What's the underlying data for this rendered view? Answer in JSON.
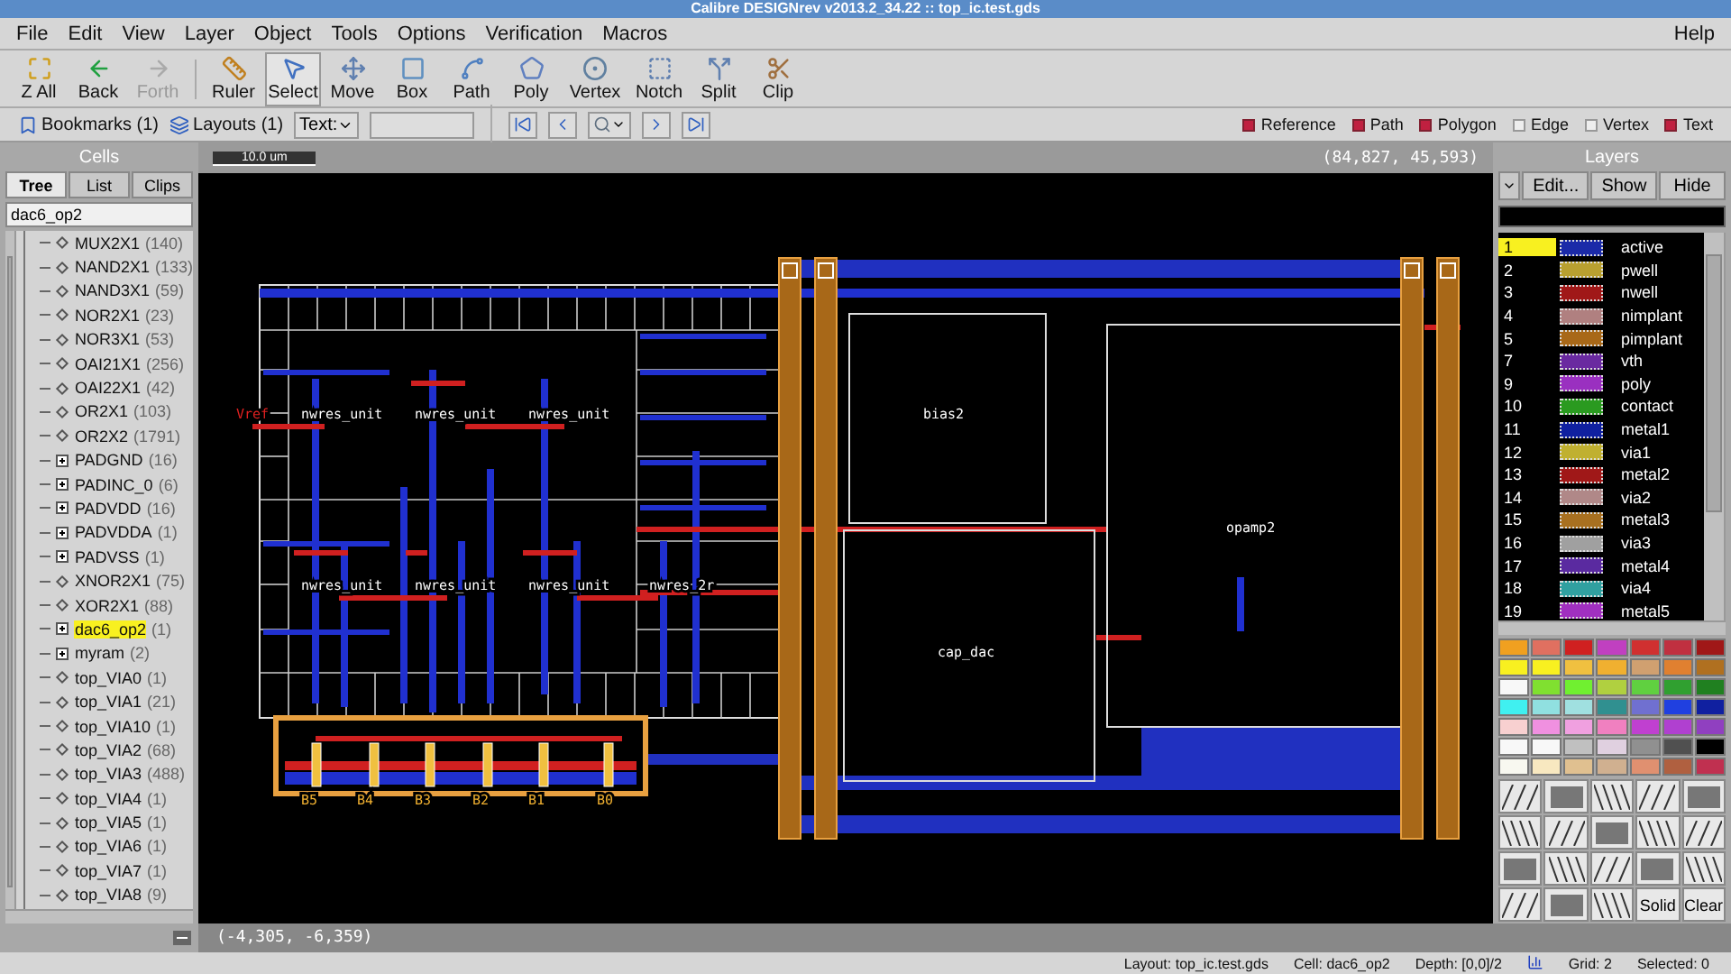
{
  "window": {
    "title": "Calibre DESIGNrev v2013.2_34.22 :: top_ic.test.gds"
  },
  "menu": {
    "left": [
      "File",
      "Edit",
      "View",
      "Layer",
      "Object",
      "Tools",
      "Options",
      "Verification",
      "Macros"
    ],
    "right": [
      "Help"
    ]
  },
  "toolbar": [
    {
      "label": "Z All",
      "disabled": false,
      "selected": false
    },
    {
      "label": "Back",
      "disabled": false,
      "selected": false
    },
    {
      "label": "Forth",
      "disabled": true,
      "selected": false
    },
    {
      "label": "Ruler",
      "disabled": false,
      "selected": false
    },
    {
      "label": "Select",
      "disabled": false,
      "selected": true
    },
    {
      "label": "Move",
      "disabled": false,
      "selected": false
    },
    {
      "label": "Box",
      "disabled": false,
      "selected": false
    },
    {
      "label": "Path",
      "disabled": false,
      "selected": false
    },
    {
      "label": "Poly",
      "disabled": false,
      "selected": false
    },
    {
      "label": "Vertex",
      "disabled": false,
      "selected": false
    },
    {
      "label": "Notch",
      "disabled": false,
      "selected": false
    },
    {
      "label": "Split",
      "disabled": false,
      "selected": false
    },
    {
      "label": "Clip",
      "disabled": false,
      "selected": false
    }
  ],
  "navbar": {
    "bookmarks": "Bookmarks (1)",
    "layouts": "Layouts (1)",
    "text_label": "Text:"
  },
  "filters": [
    {
      "label": "Reference",
      "checked": true
    },
    {
      "label": "Path",
      "checked": true
    },
    {
      "label": "Polygon",
      "checked": true
    },
    {
      "label": "Edge",
      "checked": false
    },
    {
      "label": "Vertex",
      "checked": false
    },
    {
      "label": "Text",
      "checked": true
    }
  ],
  "cells": {
    "title": "Cells",
    "tabs": [
      {
        "label": "Tree",
        "selected": true
      },
      {
        "label": "List",
        "selected": false
      },
      {
        "label": "Clips",
        "selected": false
      }
    ],
    "filter": "dac6_op2",
    "items": [
      {
        "name": "MUX2X1",
        "count": "(140)",
        "kind": "leaf",
        "selected": false
      },
      {
        "name": "NAND2X1",
        "count": "(133)",
        "kind": "leaf",
        "selected": false
      },
      {
        "name": "NAND3X1",
        "count": "(59)",
        "kind": "leaf",
        "selected": false
      },
      {
        "name": "NOR2X1",
        "count": "(23)",
        "kind": "leaf",
        "selected": false
      },
      {
        "name": "NOR3X1",
        "count": "(53)",
        "kind": "leaf",
        "selected": false
      },
      {
        "name": "OAI21X1",
        "count": "(256)",
        "kind": "leaf",
        "selected": false
      },
      {
        "name": "OAI22X1",
        "count": "(42)",
        "kind": "leaf",
        "selected": false
      },
      {
        "name": "OR2X1",
        "count": "(103)",
        "kind": "leaf",
        "selected": false
      },
      {
        "name": "OR2X2",
        "count": "(1791)",
        "kind": "leaf",
        "selected": false
      },
      {
        "name": "PADGND",
        "count": "(16)",
        "kind": "group",
        "selected": false
      },
      {
        "name": "PADINC_0",
        "count": "(6)",
        "kind": "group",
        "selected": false
      },
      {
        "name": "PADVDD",
        "count": "(16)",
        "kind": "group",
        "selected": false
      },
      {
        "name": "PADVDDA",
        "count": "(1)",
        "kind": "group",
        "selected": false
      },
      {
        "name": "PADVSS",
        "count": "(1)",
        "kind": "group",
        "selected": false
      },
      {
        "name": "XNOR2X1",
        "count": "(75)",
        "kind": "leaf",
        "selected": false
      },
      {
        "name": "XOR2X1",
        "count": "(88)",
        "kind": "leaf",
        "selected": false
      },
      {
        "name": "dac6_op2",
        "count": "(1)",
        "kind": "group",
        "selected": true
      },
      {
        "name": "myram",
        "count": "(2)",
        "kind": "group",
        "selected": false
      },
      {
        "name": "top_VIA0",
        "count": "(1)",
        "kind": "leaf",
        "selected": false
      },
      {
        "name": "top_VIA1",
        "count": "(21)",
        "kind": "leaf",
        "selected": false
      },
      {
        "name": "top_VIA10",
        "count": "(1)",
        "kind": "leaf",
        "selected": false
      },
      {
        "name": "top_VIA2",
        "count": "(68)",
        "kind": "leaf",
        "selected": false
      },
      {
        "name": "top_VIA3",
        "count": "(488)",
        "kind": "leaf",
        "selected": false
      },
      {
        "name": "top_VIA4",
        "count": "(1)",
        "kind": "leaf",
        "selected": false
      },
      {
        "name": "top_VIA5",
        "count": "(1)",
        "kind": "leaf",
        "selected": false
      },
      {
        "name": "top_VIA6",
        "count": "(1)",
        "kind": "leaf",
        "selected": false
      },
      {
        "name": "top_VIA7",
        "count": "(1)",
        "kind": "leaf",
        "selected": false
      },
      {
        "name": "top_VIA8",
        "count": "(9)",
        "kind": "leaf",
        "selected": false
      }
    ]
  },
  "canvas": {
    "scale": "10.0 um",
    "cursor_position": "(84,827, 45,593)",
    "pointer_position": "(-4,305, -6,359)",
    "labels": [
      {
        "text": "Vref",
        "kind": "pin"
      },
      {
        "text": "nwres_unit",
        "kind": "cell"
      },
      {
        "text": "nwres_unit",
        "kind": "cell"
      },
      {
        "text": "nwres_unit",
        "kind": "cell"
      },
      {
        "text": "nwres_unit",
        "kind": "cell"
      },
      {
        "text": "nwres_unit",
        "kind": "cell"
      },
      {
        "text": "nwres_unit",
        "kind": "cell"
      },
      {
        "text": "nwres_2r",
        "kind": "cell"
      },
      {
        "text": "bias2",
        "kind": "cell"
      },
      {
        "text": "opamp2",
        "kind": "cell"
      },
      {
        "text": "cap_dac",
        "kind": "cell"
      },
      {
        "text": "B5",
        "kind": "pad"
      },
      {
        "text": "B4",
        "kind": "pad"
      },
      {
        "text": "B3",
        "kind": "pad"
      },
      {
        "text": "B2",
        "kind": "pad"
      },
      {
        "text": "B1",
        "kind": "pad"
      },
      {
        "text": "B0",
        "kind": "pad"
      }
    ]
  },
  "layers": {
    "title": "Layers",
    "buttons": [
      "Edit...",
      "Show",
      "Hide"
    ],
    "items": [
      {
        "number": "1",
        "name": "active",
        "color": "#1b2aa8",
        "selected": true
      },
      {
        "number": "2",
        "name": "pwell",
        "color": "#b8a030",
        "selected": false
      },
      {
        "number": "3",
        "name": "nwell",
        "color": "#a01818",
        "selected": false
      },
      {
        "number": "4",
        "name": "nimplant",
        "color": "#b08080",
        "selected": false
      },
      {
        "number": "5",
        "name": "pimplant",
        "color": "#a86818",
        "selected": false
      },
      {
        "number": "7",
        "name": "vth",
        "color": "#6a2aa0",
        "selected": false
      },
      {
        "number": "9",
        "name": "poly",
        "color": "#9a30c0",
        "selected": false
      },
      {
        "number": "10",
        "name": "contact",
        "color": "#2a9a20",
        "selected": false
      },
      {
        "number": "11",
        "name": "metal1",
        "color": "#1020a0",
        "selected": false
      },
      {
        "number": "12",
        "name": "via1",
        "color": "#c0b030",
        "selected": false
      },
      {
        "number": "13",
        "name": "metal2",
        "color": "#a01818",
        "selected": false
      },
      {
        "number": "14",
        "name": "via2",
        "color": "#b08888",
        "selected": false
      },
      {
        "number": "15",
        "name": "metal3",
        "color": "#a87020",
        "selected": false
      },
      {
        "number": "16",
        "name": "via3",
        "color": "#a0a0a0",
        "selected": false
      },
      {
        "number": "17",
        "name": "metal4",
        "color": "#5a2aa0",
        "selected": false
      },
      {
        "number": "18",
        "name": "via4",
        "color": "#30a0a0",
        "selected": false
      },
      {
        "number": "19",
        "name": "metal5",
        "color": "#a030c0",
        "selected": false
      }
    ],
    "pattern_buttons": [
      "Solid",
      "Clear"
    ]
  },
  "status": [
    {
      "label": "Layout:",
      "value": "top_ic.test.gds"
    },
    {
      "label": "Cell:",
      "value": "dac6_op2"
    },
    {
      "label": "Depth:",
      "value": "[0,0]/2"
    },
    {
      "label": "Grid:",
      "value": "2"
    },
    {
      "label": "Selected:",
      "value": "0"
    }
  ]
}
